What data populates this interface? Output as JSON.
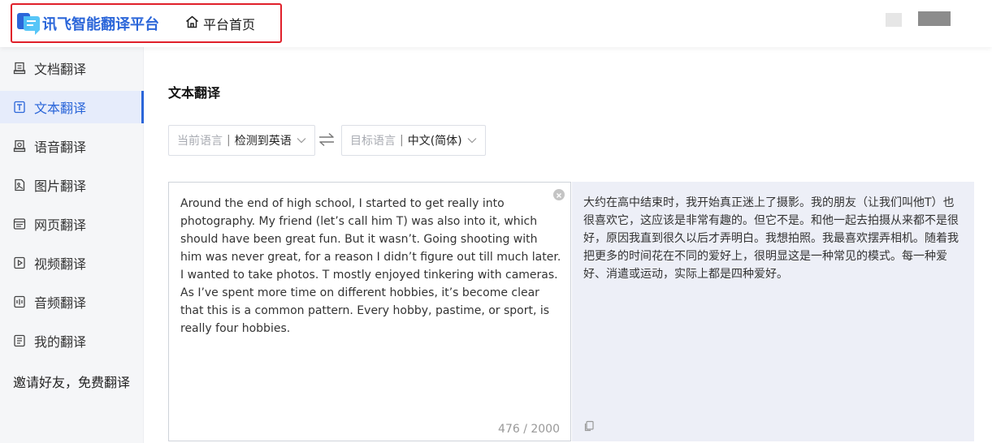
{
  "header": {
    "logo_text": "讯飞智能翻译平台",
    "home_label": "平台首页"
  },
  "sidebar": {
    "items": [
      {
        "label": "文档翻译",
        "icon": "document-icon"
      },
      {
        "label": "文本翻译",
        "icon": "text-icon",
        "active": true
      },
      {
        "label": "语音翻译",
        "icon": "voice-icon"
      },
      {
        "label": "图片翻译",
        "icon": "image-icon"
      },
      {
        "label": "网页翻译",
        "icon": "webpage-icon"
      },
      {
        "label": "视频翻译",
        "icon": "video-icon"
      },
      {
        "label": "音频翻译",
        "icon": "audio-icon"
      },
      {
        "label": "我的翻译",
        "icon": "my-translation-icon"
      }
    ],
    "invite_label": "邀请好友，免费翻译"
  },
  "main": {
    "title": "文本翻译",
    "source_lang": {
      "label": "当前语言",
      "value": "检测到英语"
    },
    "target_lang": {
      "label": "目标语言",
      "value": "中文(简体)"
    },
    "source_text": "Around the end of high school, I started to get really into photography. My friend (let’s call him T) was also into it, which should have been great fun. But it wasn’t. Going shooting with him was never great, for a reason I didn’t figure out till much later. I wanted to take photos. T mostly enjoyed tinkering with cameras. As I’ve spent more time on different hobbies, it’s become clear that this is a common pattern. Every hobby, pastime, or sport, is really four hobbies.",
    "char_count": "476 / 2000",
    "target_text": "大约在高中结束时，我开始真正迷上了摄影。我的朋友（让我们叫他T）也很喜欢它，这应该是非常有趣的。但它不是。和他一起去拍摄从来都不是很好，原因我直到很久以后才弄明白。我想拍照。我最喜欢摆弄相机。随着我把更多的时间花在不同的爱好上，很明显这是一种常见的模式。每一种爱好、消遣或运动，实际上都是四种爱好。"
  },
  "colors": {
    "accent": "#2b66d9",
    "highlight_border": "#e0202a",
    "sidebar_bg": "#f5f6f8",
    "sidebar_active_bg": "#e6ecfb",
    "target_panel_bg": "#edeff7"
  }
}
